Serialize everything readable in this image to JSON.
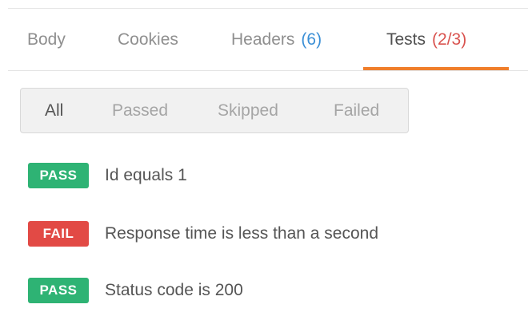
{
  "tabs": {
    "body": "Body",
    "cookies": "Cookies",
    "headers": "Headers",
    "headers_count": "(6)",
    "tests": "Tests",
    "tests_count": "(2/3)"
  },
  "filters": {
    "all": "All",
    "passed": "Passed",
    "skipped": "Skipped",
    "failed": "Failed"
  },
  "results": [
    {
      "status": "PASS",
      "name": "Id equals 1"
    },
    {
      "status": "FAIL",
      "name": "Response time is less than a second"
    },
    {
      "status": "PASS",
      "name": "Status code is 200"
    }
  ],
  "colors": {
    "accent": "#f07e2b",
    "pass": "#2eb374",
    "fail": "#e24a45",
    "headers_count": "#3a8fd6",
    "tests_count": "#d9534f"
  }
}
